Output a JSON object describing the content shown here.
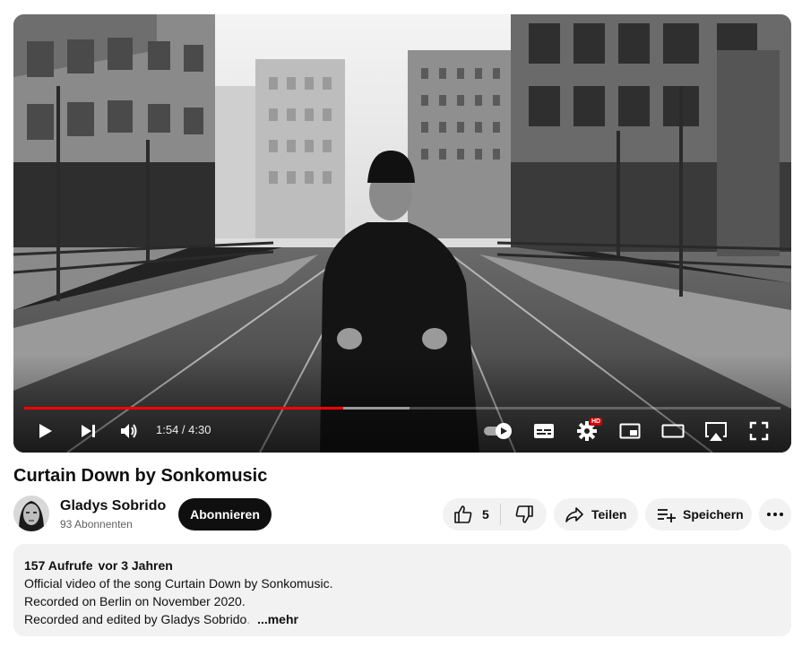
{
  "player": {
    "current_time": "1:54",
    "time_separator": " / ",
    "duration": "4:30",
    "progress_played": 0.422,
    "progress_buffered": 0.51,
    "hd_badge": "HD",
    "accent_color": "#ff0000"
  },
  "video": {
    "title": "Curtain Down by Sonkomusic"
  },
  "channel": {
    "name": "Gladys Sobrido",
    "subscribers": "93 Abonnenten",
    "subscribe_label": "Abonnieren"
  },
  "actions": {
    "like_count": "5",
    "share_label": "Teilen",
    "save_label": "Speichern"
  },
  "description": {
    "views": "157 Aufrufe",
    "age": "vor 3 Jahren",
    "lines": [
      "Official video of the song Curtain Down by Sonkomusic.",
      "Recorded on Berlin on November 2020.",
      "Recorded and edited by Gladys Sobrido"
    ],
    "truncated_tail": ".",
    "more_label": "...mehr"
  }
}
